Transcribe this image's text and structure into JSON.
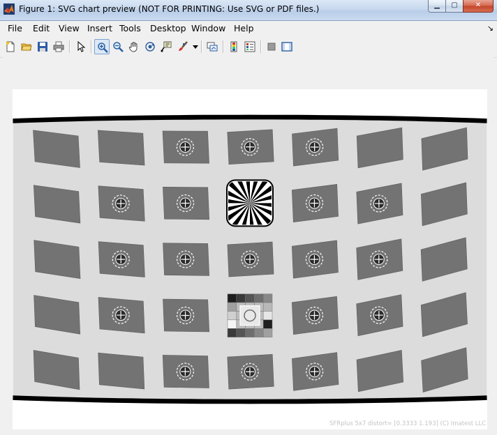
{
  "window": {
    "title": "Figure 1: SVG chart preview (NOT FOR PRINTING: Use SVG or PDF files.)",
    "minimize_label": "▁",
    "maximize_label": "▢",
    "close_label": "✕"
  },
  "menu": {
    "items": [
      "File",
      "Edit",
      "View",
      "Insert",
      "Tools",
      "Desktop",
      "Window",
      "Help"
    ],
    "overflow_arrow": "↘"
  },
  "toolbar": {
    "buttons": [
      "new-figure",
      "open-file",
      "save",
      "print",
      "edit-plot",
      "zoom-in",
      "zoom-out",
      "pan",
      "rotate-3d",
      "data-cursor",
      "brush",
      "brush-menu",
      "link-plot",
      "insert-colorbar",
      "insert-legend",
      "hide-plot-tools",
      "show-plot-tools"
    ],
    "active": "zoom-in"
  },
  "chart": {
    "footnote": "SFRplus 5x7  distort= [0.3333  1.193]  (C) Imatest LLC",
    "colors": {
      "background": "#dcdcdc",
      "patch": "#737373",
      "bar": "#000000",
      "canvas": "#ffffff"
    }
  }
}
